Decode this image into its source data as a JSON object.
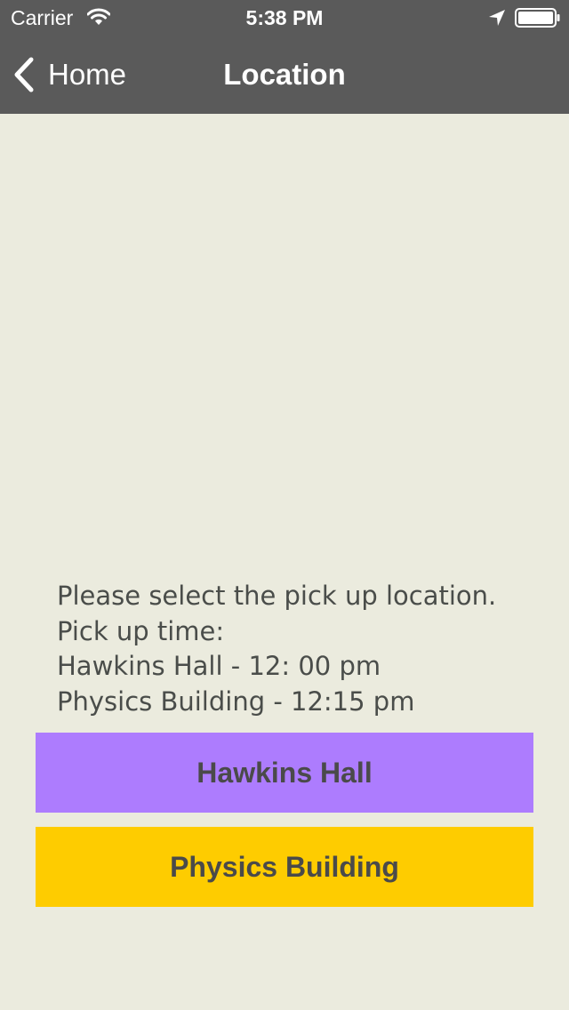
{
  "status_bar": {
    "carrier": "Carrier",
    "time": "5:38 PM",
    "icons": [
      "wifi-icon",
      "location-arrow-icon",
      "battery-icon"
    ]
  },
  "nav_bar": {
    "back_label": "Home",
    "back_icon": "chevron-left-icon",
    "title": "Location"
  },
  "instructions": {
    "line1": "Please select the pick up location.",
    "line2": "Pick up time:",
    "line3": "Hawkins Hall - 12: 00 pm",
    "line4": "Physics Building - 12:15 pm"
  },
  "buttons": {
    "hawkins_label": "Hawkins Hall",
    "physics_label": "Physics Building"
  },
  "colors": {
    "top_bar": "#5a5a5a",
    "background": "#ebebde",
    "hawkins_button": "#ad7cfe",
    "physics_button": "#fecc00",
    "text": "#4a4d4a"
  }
}
